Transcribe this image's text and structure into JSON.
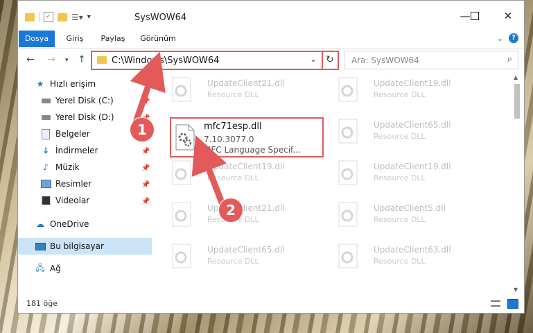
{
  "window": {
    "title": "SysWOW64"
  },
  "ribbon": {
    "tabs": [
      "Dosya",
      "Giriş",
      "Paylaş",
      "Görünüm"
    ],
    "help": "?"
  },
  "navigation": {
    "back": "←",
    "forward": "→",
    "up": "↑",
    "address": "C:\\Windows\\SysWOW64",
    "search_placeholder": "Ara: SysWOW64"
  },
  "sidebar": {
    "quick_access": "Hızlı erişim",
    "items": [
      "Yerel Disk (C:)",
      "Yerel Disk (D:)",
      "Belgeler",
      "İndirmeler",
      "Müzik",
      "Resimler",
      "Videolar"
    ],
    "onedrive": "OneDrive",
    "this_pc": "Bu bilgisayar",
    "network": "Ağ"
  },
  "files": [
    {
      "name": "UpdateClient21.dll",
      "desc": "Resource DLL"
    },
    {
      "name": "UpdateClient19.dll",
      "desc": "Resource DLL"
    },
    {
      "name": "UpdateClient65.dll",
      "desc": "Resource DLL"
    },
    {
      "name": "UpdateClient19.dll",
      "desc": "Resource DLL"
    },
    {
      "name": "UpdateClient19.dll",
      "desc": "Resource DLL"
    },
    {
      "name": "UpdateClient21.dll",
      "desc": "Resource DLL"
    },
    {
      "name": "UpdateClient5.dll",
      "desc": "Resource DLL"
    },
    {
      "name": "UpdateClient65.dll",
      "desc": "Resource DLL"
    },
    {
      "name": "UpdateClient63.dll",
      "desc": "Resource DLL"
    }
  ],
  "featured_file": {
    "name": "mfc71esp.dll",
    "version": "7.10.3077.0",
    "desc": "MFC Language Specif..."
  },
  "status": {
    "count": "181 öğe"
  },
  "callouts": [
    "1",
    "2"
  ],
  "colors": {
    "accent": "#1a78d6",
    "highlight": "#e35a5a",
    "selected": "#cce4f7",
    "folder": "#f4c54d"
  }
}
